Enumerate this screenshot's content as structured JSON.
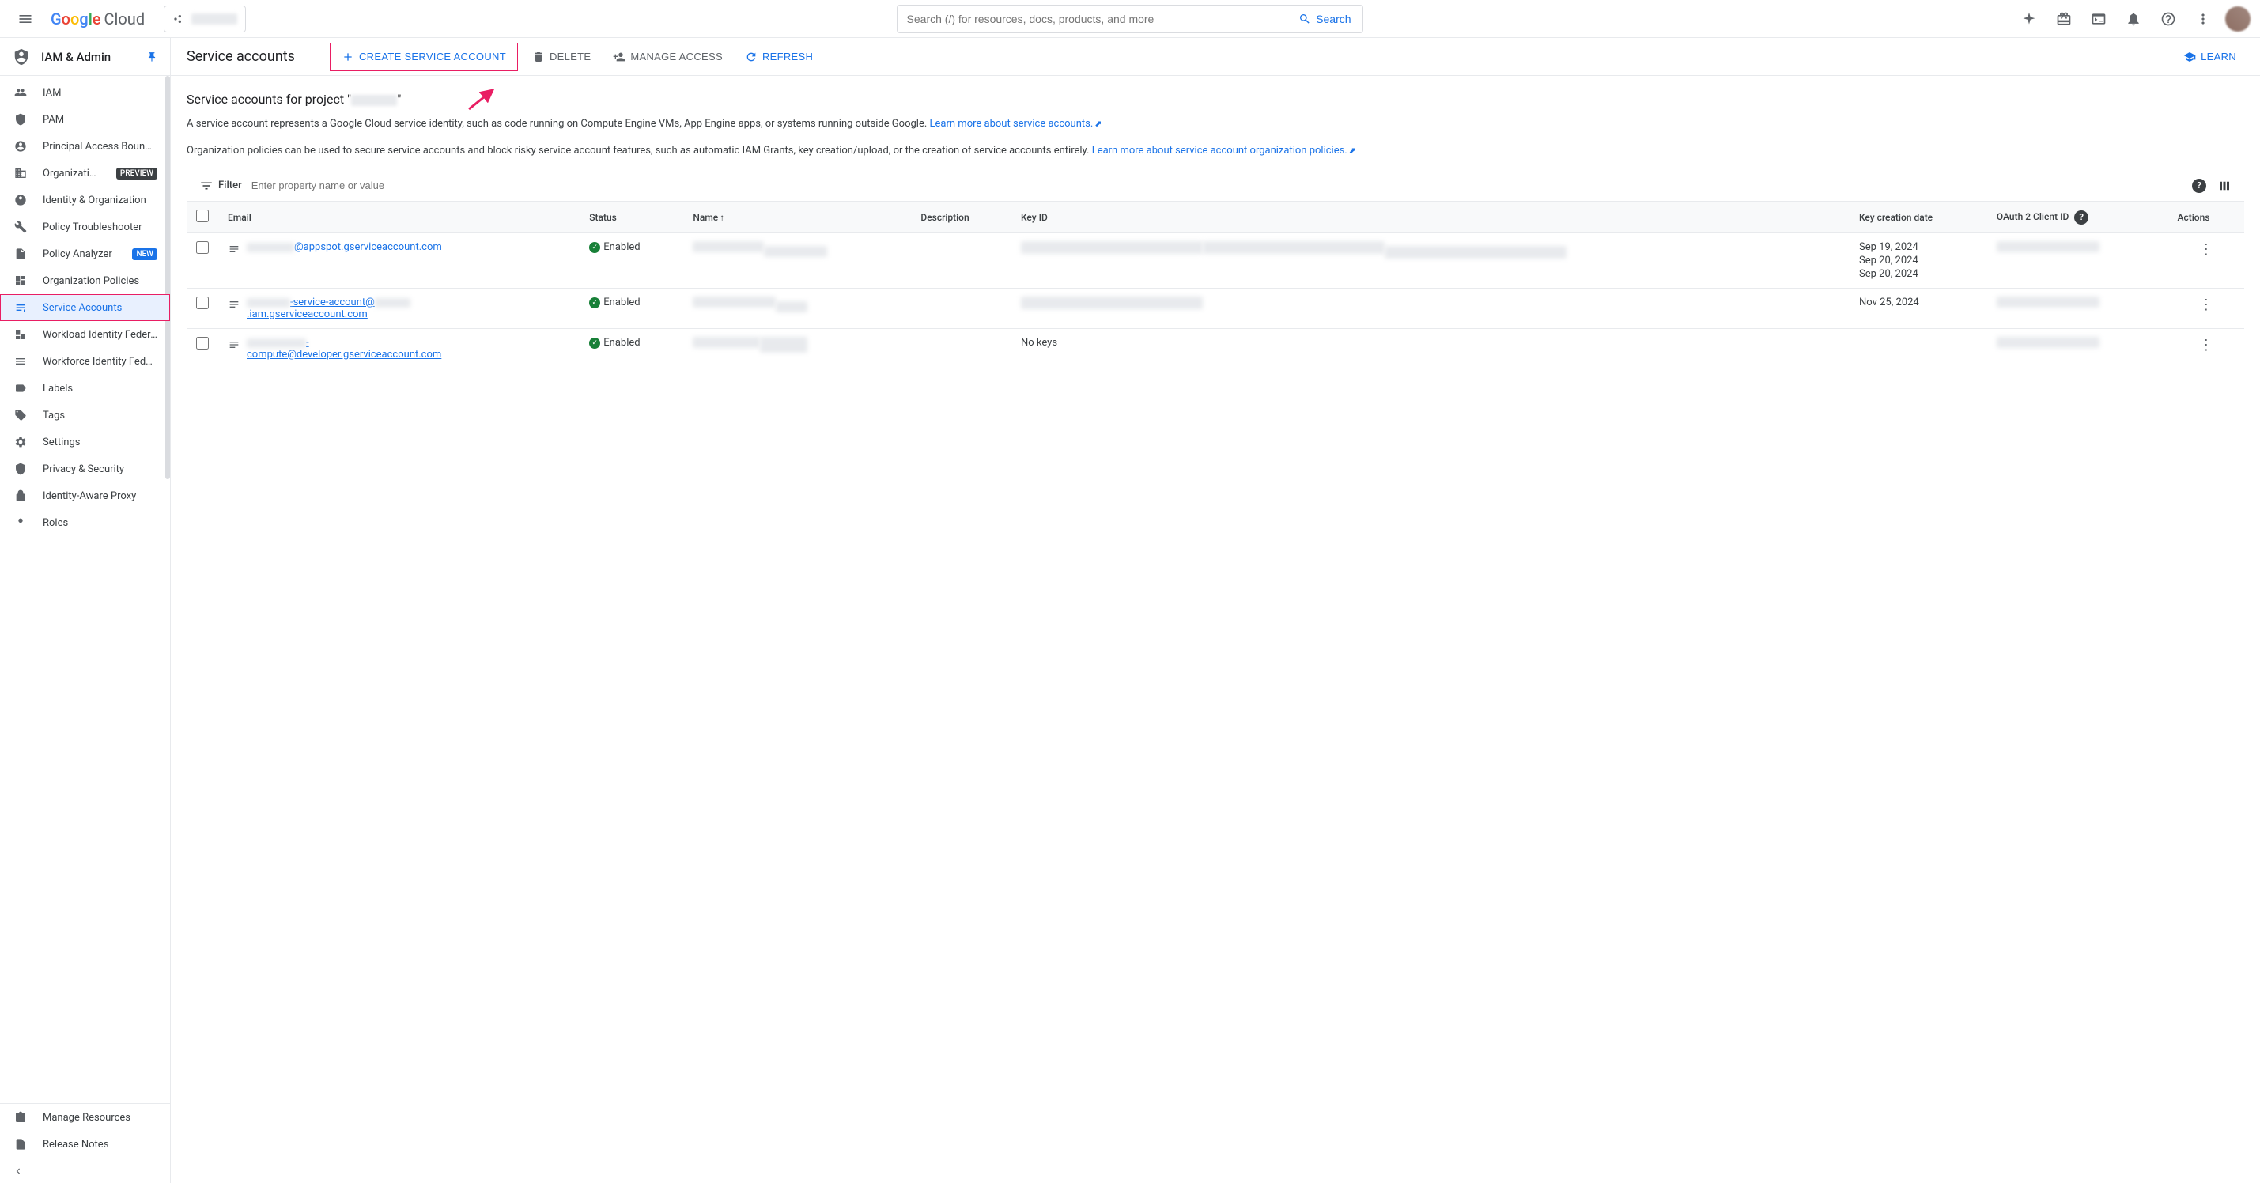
{
  "header": {
    "logo_cloud": "Cloud",
    "search_placeholder": "Search (/) for resources, docs, products, and more",
    "search_button": "Search"
  },
  "sidebar": {
    "section_title": "IAM & Admin",
    "items": [
      {
        "label": "IAM"
      },
      {
        "label": "PAM"
      },
      {
        "label": "Principal Access Boundary"
      },
      {
        "label": "Organizations",
        "badge": "PREVIEW"
      },
      {
        "label": "Identity & Organization"
      },
      {
        "label": "Policy Troubleshooter"
      },
      {
        "label": "Policy Analyzer",
        "badge": "NEW"
      },
      {
        "label": "Organization Policies"
      },
      {
        "label": "Service Accounts"
      },
      {
        "label": "Workload Identity Federation"
      },
      {
        "label": "Workforce Identity Federation"
      },
      {
        "label": "Labels"
      },
      {
        "label": "Tags"
      },
      {
        "label": "Settings"
      },
      {
        "label": "Privacy & Security"
      },
      {
        "label": "Identity-Aware Proxy"
      },
      {
        "label": "Roles"
      }
    ],
    "footer": [
      {
        "label": "Manage Resources"
      },
      {
        "label": "Release Notes"
      }
    ]
  },
  "toolbar": {
    "title": "Service accounts",
    "create": "Create Service Account",
    "delete": "Delete",
    "manage": "Manage Access",
    "refresh": "Refresh",
    "learn": "Learn"
  },
  "page": {
    "heading_prefix": "Service accounts for project \"",
    "heading_suffix": "\"",
    "desc1": "A service account represents a Google Cloud service identity, such as code running on Compute Engine VMs, App Engine apps, or systems running outside Google.",
    "desc1_link": "Learn more about service accounts.",
    "desc2": "Organization policies can be used to secure service accounts and block risky service account features, such as automatic IAM Grants, key creation/upload, or the creation of service accounts entirely.",
    "desc2_link": "Learn more about service account organization policies."
  },
  "filter": {
    "label": "Filter",
    "placeholder": "Enter property name or value"
  },
  "table": {
    "cols": {
      "email": "Email",
      "status": "Status",
      "name": "Name",
      "description": "Description",
      "keyid": "Key ID",
      "keydate": "Key creation date",
      "oauth": "OAuth 2 Client ID",
      "actions": "Actions"
    },
    "rows": [
      {
        "email_suffix": "@appspot.gserviceaccount.com",
        "status": "Enabled",
        "dates": [
          "Sep 19, 2024",
          "Sep 20, 2024",
          "Sep 20, 2024"
        ],
        "no_keys": false
      },
      {
        "email_mid": "-service-account@",
        "email_suffix": ".iam.gserviceaccount.com",
        "status": "Enabled",
        "dates": [
          "Nov 25, 2024"
        ],
        "no_keys": false
      },
      {
        "email_mid": "-compute@developer.gserviceaccount.com",
        "status": "Enabled",
        "no_keys_text": "No keys",
        "no_keys": true
      }
    ]
  }
}
